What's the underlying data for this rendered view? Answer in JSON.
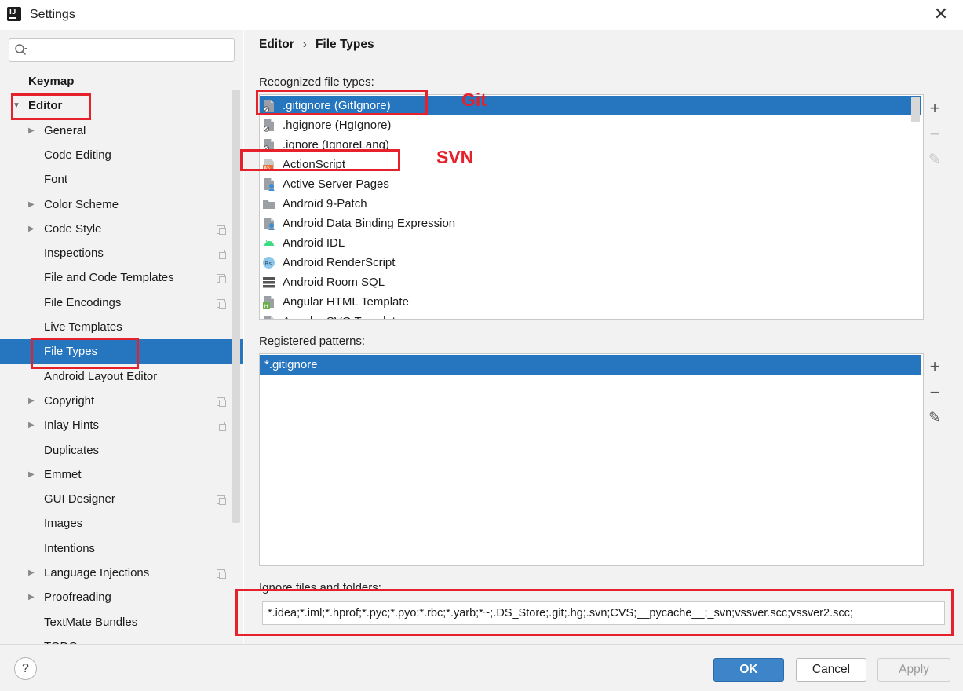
{
  "window": {
    "title": "Settings"
  },
  "sidebar": {
    "search_placeholder": "",
    "items": [
      {
        "label": "Keymap",
        "bold": true,
        "level": 0,
        "arrow": "",
        "copy": false
      },
      {
        "label": "Editor",
        "bold": true,
        "level": 0,
        "arrow": "down",
        "copy": false
      },
      {
        "label": "General",
        "level": 1,
        "arrow": "right",
        "copy": false
      },
      {
        "label": "Code Editing",
        "level": 1,
        "arrow": "",
        "copy": false
      },
      {
        "label": "Font",
        "level": 1,
        "arrow": "",
        "copy": false
      },
      {
        "label": "Color Scheme",
        "level": 1,
        "arrow": "right",
        "copy": false
      },
      {
        "label": "Code Style",
        "level": 1,
        "arrow": "right",
        "copy": true
      },
      {
        "label": "Inspections",
        "level": 1,
        "arrow": "",
        "copy": true
      },
      {
        "label": "File and Code Templates",
        "level": 1,
        "arrow": "",
        "copy": true
      },
      {
        "label": "File Encodings",
        "level": 1,
        "arrow": "",
        "copy": true
      },
      {
        "label": "Live Templates",
        "level": 1,
        "arrow": "",
        "copy": false
      },
      {
        "label": "File Types",
        "level": 1,
        "arrow": "",
        "copy": false,
        "selected": true
      },
      {
        "label": "Android Layout Editor",
        "level": 1,
        "arrow": "",
        "copy": false
      },
      {
        "label": "Copyright",
        "level": 1,
        "arrow": "right",
        "copy": true
      },
      {
        "label": "Inlay Hints",
        "level": 1,
        "arrow": "right",
        "copy": true
      },
      {
        "label": "Duplicates",
        "level": 1,
        "arrow": "",
        "copy": false
      },
      {
        "label": "Emmet",
        "level": 1,
        "arrow": "right",
        "copy": false
      },
      {
        "label": "GUI Designer",
        "level": 1,
        "arrow": "",
        "copy": true
      },
      {
        "label": "Images",
        "level": 1,
        "arrow": "",
        "copy": false
      },
      {
        "label": "Intentions",
        "level": 1,
        "arrow": "",
        "copy": false
      },
      {
        "label": "Language Injections",
        "level": 1,
        "arrow": "right",
        "copy": true
      },
      {
        "label": "Proofreading",
        "level": 1,
        "arrow": "right",
        "copy": false
      },
      {
        "label": "TextMate Bundles",
        "level": 1,
        "arrow": "",
        "copy": false
      },
      {
        "label": "TODO",
        "level": 1,
        "arrow": "",
        "copy": false
      }
    ]
  },
  "breadcrumb": {
    "parent": "Editor",
    "separator": "›",
    "current": "File Types"
  },
  "recognized": {
    "label": "Recognized file types:",
    "items": [
      {
        "text": ".gitignore (GitIgnore)",
        "icon": "ignore-file-icon",
        "selected": true
      },
      {
        "text": ".hgignore (HgIgnore)",
        "icon": "ignore-file-icon"
      },
      {
        "text": ".ignore (IgnoreLang)",
        "icon": "ignore-file-icon"
      },
      {
        "text": "ActionScript",
        "icon": "actionscript-icon"
      },
      {
        "text": "Active Server Pages",
        "icon": "asp-file-icon"
      },
      {
        "text": "Android 9-Patch",
        "icon": "folder-icon"
      },
      {
        "text": "Android Data Binding Expression",
        "icon": "data-binding-icon"
      },
      {
        "text": "Android IDL",
        "icon": "android-icon"
      },
      {
        "text": "Android RenderScript",
        "icon": "renderscript-icon"
      },
      {
        "text": "Android Room SQL",
        "icon": "database-icon"
      },
      {
        "text": "Angular HTML Template",
        "icon": "angular-html-icon"
      },
      {
        "text": "Angular SVG Template",
        "icon": "angular-svg-icon"
      }
    ]
  },
  "patterns": {
    "label": "Registered patterns:",
    "items": [
      {
        "text": "*.gitignore",
        "selected": true
      }
    ]
  },
  "tools": {
    "add": "+",
    "remove": "−",
    "edit": "✎"
  },
  "ignore": {
    "label": "Ignore files and folders:",
    "value": "*.idea;*.iml;*.hprof;*.pyc;*.pyo;*.rbc;*.yarb;*~;.DS_Store;.git;.hg;.svn;CVS;__pycache__;_svn;vssver.scc;vssver2.scc;"
  },
  "buttons": {
    "help": "?",
    "ok": "OK",
    "cancel": "Cancel",
    "apply": "Apply"
  },
  "annotations": {
    "git": "Git",
    "svn": "SVN"
  },
  "colors": {
    "selection": "#2675bf",
    "annotation": "#e5212b",
    "ok_button": "#3d84c9"
  }
}
